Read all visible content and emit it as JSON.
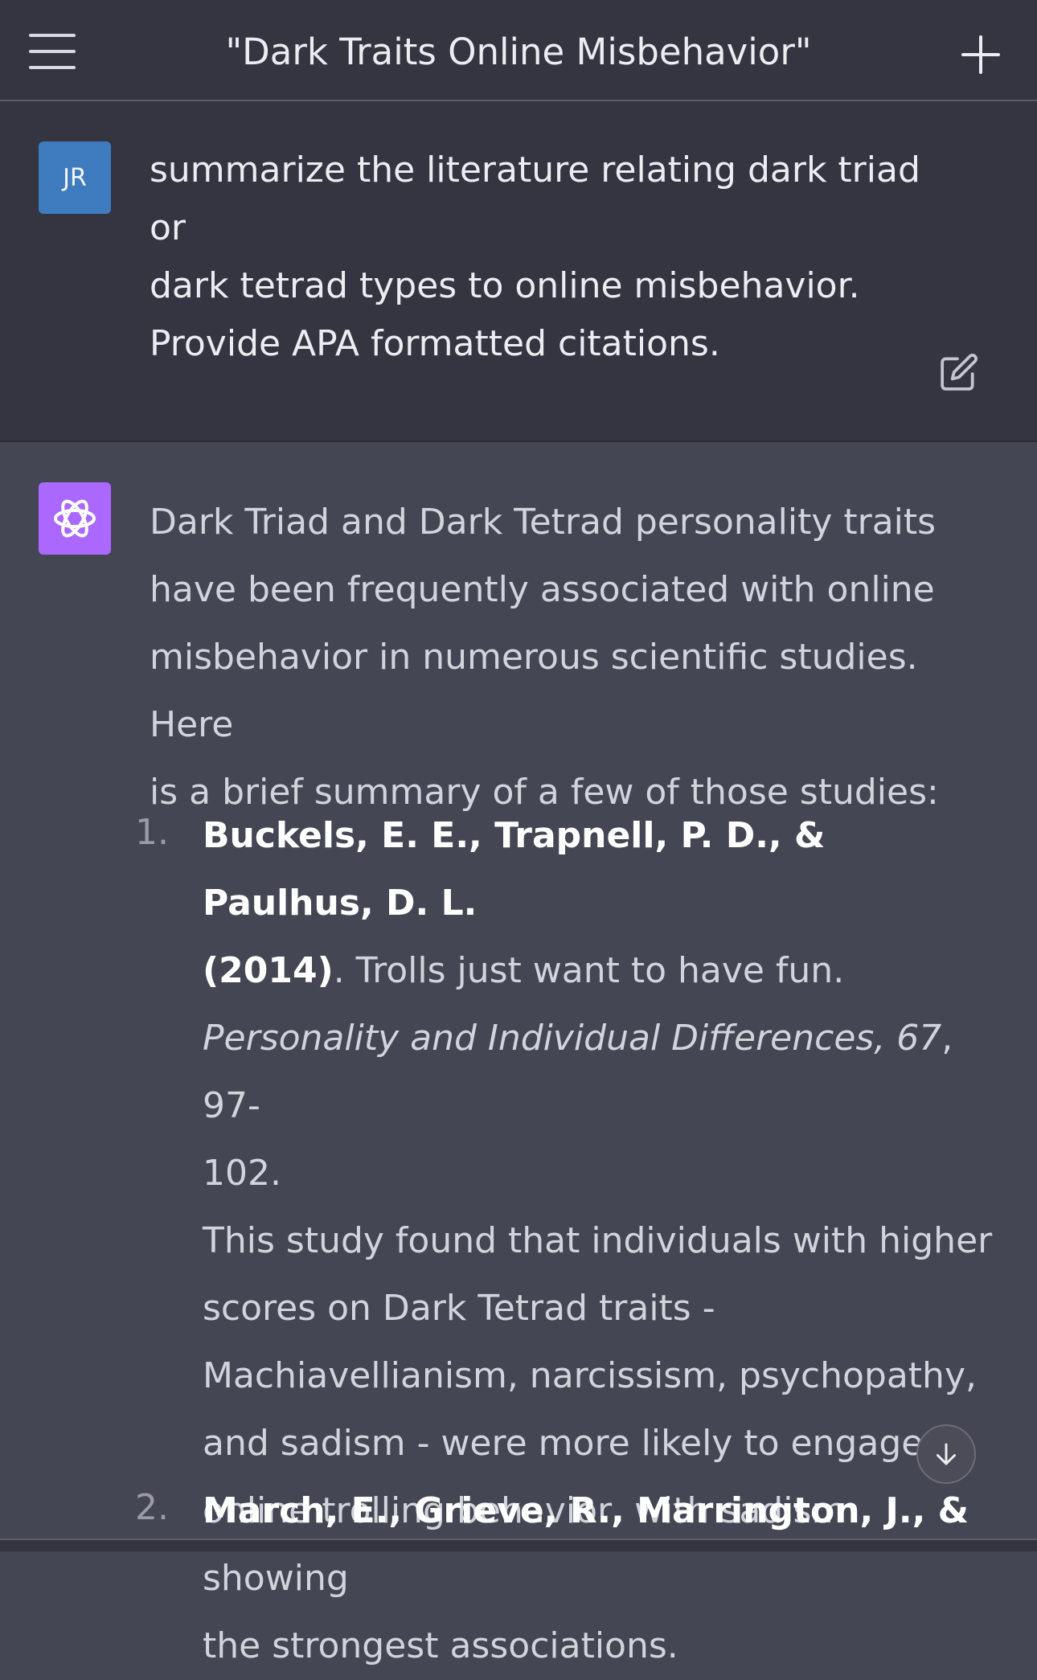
{
  "header": {
    "title": "\"Dark Traits Online Misbehavior\""
  },
  "user_message": {
    "avatar_initials": "JR",
    "lines": [
      "summarize the literature relating dark triad or",
      "dark tetrad types to online misbehavior.",
      "Provide APA formatted citations."
    ]
  },
  "assistant_message": {
    "intro_lines": [
      "Dark Triad and Dark Tetrad personality traits",
      "have been frequently associated with online",
      "misbehavior in numerous scientific studies. Here",
      "is a brief summary of a few of those studies:"
    ],
    "items": [
      {
        "number": "1.",
        "authors_line1": "Buckels, E. E., Trapnell, P. D., & Paulhus, D. L.",
        "authors_line2": "(2014)",
        "title_after": ". Trolls just want to have fun.",
        "journal": "Personality and Individual Differences, 67",
        "pages_part1": ", 97-",
        "pages_part2": "102.",
        "summary_lines": [
          "This study found that individuals with higher",
          "scores on Dark Tetrad traits -",
          "Machiavellianism, narcissism, psychopathy,",
          "and sadism - were more likely to engage in",
          "online trolling behavior, with sadism showing",
          "the strongest associations."
        ]
      },
      {
        "number": "2.",
        "authors_line1": "March, E., Grieve, R., Marrington, J., &"
      }
    ]
  },
  "colors": {
    "header_bg": "#343541",
    "assistant_bg": "#444654",
    "user_avatar": "#3f7cbf",
    "bot_avatar": "#ab68ff"
  },
  "icons": [
    "menu-icon",
    "plus-icon",
    "edit-icon",
    "openai-logo-icon",
    "arrow-down-icon"
  ]
}
